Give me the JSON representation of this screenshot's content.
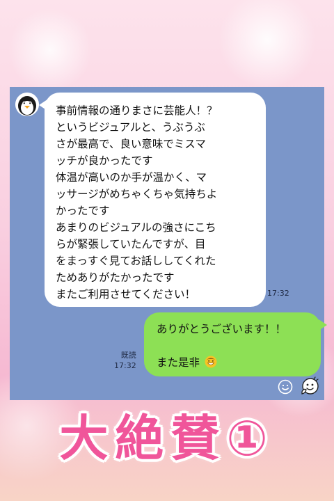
{
  "chat": {
    "incoming": {
      "avatar_icon": "penguin-avatar-icon",
      "lines": [
        "事前情報の通りまさに芸能人！？",
        "というビジュアルと、うぶうぶ",
        "さが最高で、良い意味でミスマ",
        "ッチが良かったです",
        "体温が高いのか手が温かく、マ",
        "ッサージがめちゃくちゃ気持ちよ",
        "かったです",
        "あまりのビジュアルの強さにこち",
        "らが緊張していたんですが、目",
        "をまっすぐ見てお話ししてくれた",
        "ためありがたかったです",
        "またご利用させてください！"
      ],
      "time": "17:32"
    },
    "outgoing": {
      "line1": "ありがとうございます！！",
      "line2": "また是非",
      "emoji_icon": "grinning-emoji-icon",
      "read_label": "既読",
      "time": "17:32"
    },
    "toolbar": {
      "emoji_button_icon": "smiley-icon",
      "sticker_button_icon": "sticker-icon"
    }
  },
  "banner": {
    "text": "大絶賛①"
  },
  "colors": {
    "chat_background": "#7b96c9",
    "outgoing_bubble": "#8de055",
    "banner_text": "#f0559a"
  }
}
